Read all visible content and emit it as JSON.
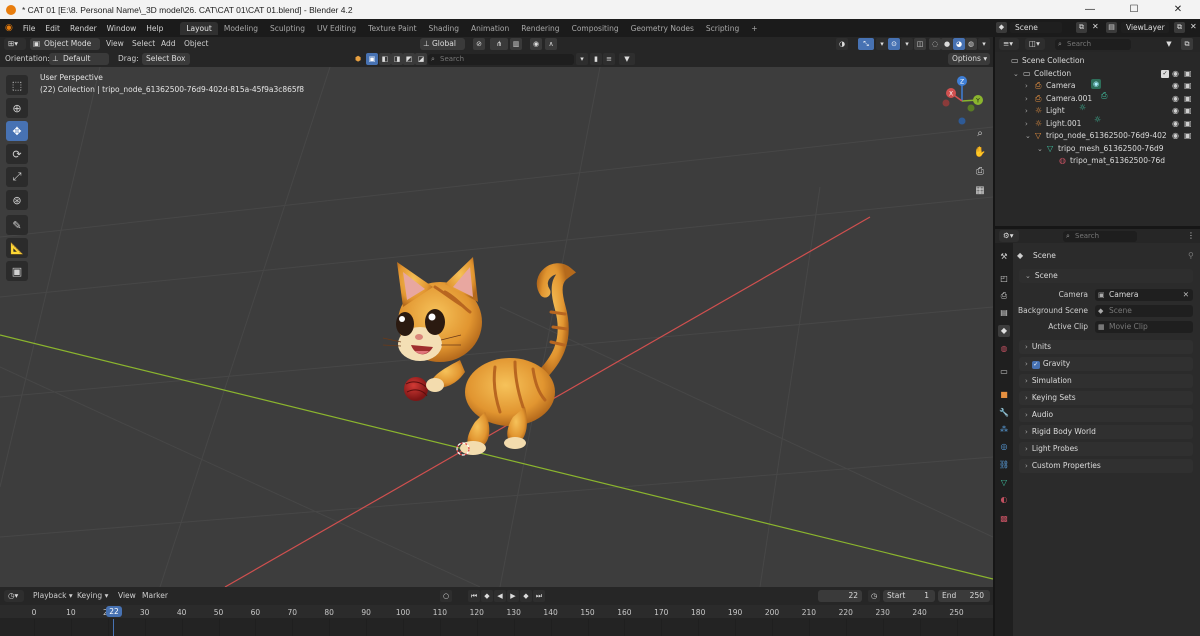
{
  "window": {
    "title": "* CAT 01 [E:\\8. Personal Name\\_3D model\\26. CAT\\CAT 01\\CAT 01.blend] - Blender 4.2",
    "minimize": "—",
    "maximize": "☐",
    "close": "✕"
  },
  "menu": {
    "items": [
      "File",
      "Edit",
      "Render",
      "Window",
      "Help"
    ],
    "workspaces": [
      "Layout",
      "Modeling",
      "Sculpting",
      "UV Editing",
      "Texture Paint",
      "Shading",
      "Animation",
      "Rendering",
      "Compositing",
      "Geometry Nodes",
      "Scripting"
    ],
    "active_workspace": "Layout",
    "add_workspace": "+",
    "scene": "Scene",
    "view_layer": "ViewLayer"
  },
  "viewport_header": {
    "mode": "Object Mode",
    "menus": [
      "View",
      "Select",
      "Add",
      "Object"
    ],
    "transform_orientation": "Global",
    "orientation_label": "Orientation:",
    "orientation_value": "Default",
    "drag_label": "Drag:",
    "drag_value": "Select Box",
    "search_placeholder": "Search",
    "options": "Options"
  },
  "viewport": {
    "perspective_label": "User Perspective",
    "collection_info": "(22) Collection | tripo_node_61362500-76d9-402d-815a-45f9a3c865f8",
    "gizmo_axes": [
      "X",
      "Y",
      "Z"
    ]
  },
  "tools": [
    "select-box",
    "cursor",
    "move",
    "rotate",
    "scale",
    "transform",
    "annotate",
    "measure",
    "add-cube"
  ],
  "active_tool": "move",
  "timeline": {
    "menus": [
      "Playback",
      "Keying",
      "View",
      "Marker"
    ],
    "current_frame": "22",
    "start_label": "Start",
    "start_value": "1",
    "end_label": "End",
    "end_value": "250",
    "ruler": [
      "0",
      "10",
      "20",
      "30",
      "40",
      "50",
      "60",
      "70",
      "80",
      "90",
      "100",
      "110",
      "120",
      "130",
      "140",
      "150",
      "160",
      "170",
      "180",
      "190",
      "200",
      "210",
      "220",
      "230",
      "240",
      "250"
    ]
  },
  "outliner": {
    "search_placeholder": "Search",
    "rows": [
      {
        "label": "Scene Collection",
        "depth": 0,
        "icon": "scene-collection-icon",
        "color": "#d0d0d0"
      },
      {
        "label": "Collection",
        "depth": 1,
        "icon": "collection-icon",
        "color": "#d0d0d0"
      },
      {
        "label": "Camera",
        "depth": 2,
        "icon": "camera-object-icon",
        "color": "#e69040"
      },
      {
        "label": "Camera.001",
        "depth": 2,
        "icon": "camera-object-icon",
        "color": "#e69040"
      },
      {
        "label": "Light",
        "depth": 2,
        "icon": "light-object-icon",
        "color": "#e69040"
      },
      {
        "label": "Light.001",
        "depth": 2,
        "icon": "light-object-icon",
        "color": "#e69040"
      },
      {
        "label": "tripo_node_61362500-76d9-402",
        "depth": 2,
        "icon": "mesh-object-icon",
        "color": "#e69040"
      },
      {
        "label": "tripo_mesh_61362500-76d9",
        "depth": 3,
        "icon": "mesh-data-icon",
        "color": "#40c0a0"
      },
      {
        "label": "tripo_mat_61362500-76d",
        "depth": 4,
        "icon": "material-icon",
        "color": "#c05060"
      }
    ]
  },
  "properties": {
    "search_placeholder": "Search",
    "context": "Scene",
    "panel_title": "Scene",
    "camera_label": "Camera",
    "camera_value": "Camera",
    "background_label": "Background Scene",
    "background_value": "Scene",
    "active_clip_label": "Active Clip",
    "active_clip_value": "Movie Clip",
    "sections": [
      "Units",
      "Gravity",
      "Simulation",
      "Keying Sets",
      "Audio",
      "Rigid Body World",
      "Light Probes",
      "Custom Properties"
    ],
    "gravity_checked": true
  },
  "colors": {
    "accent": "#4772b3",
    "x_axis": "#d0504f",
    "y_axis": "#8bb52e",
    "z_axis": "#3f7fd6",
    "grid": "#474747"
  }
}
